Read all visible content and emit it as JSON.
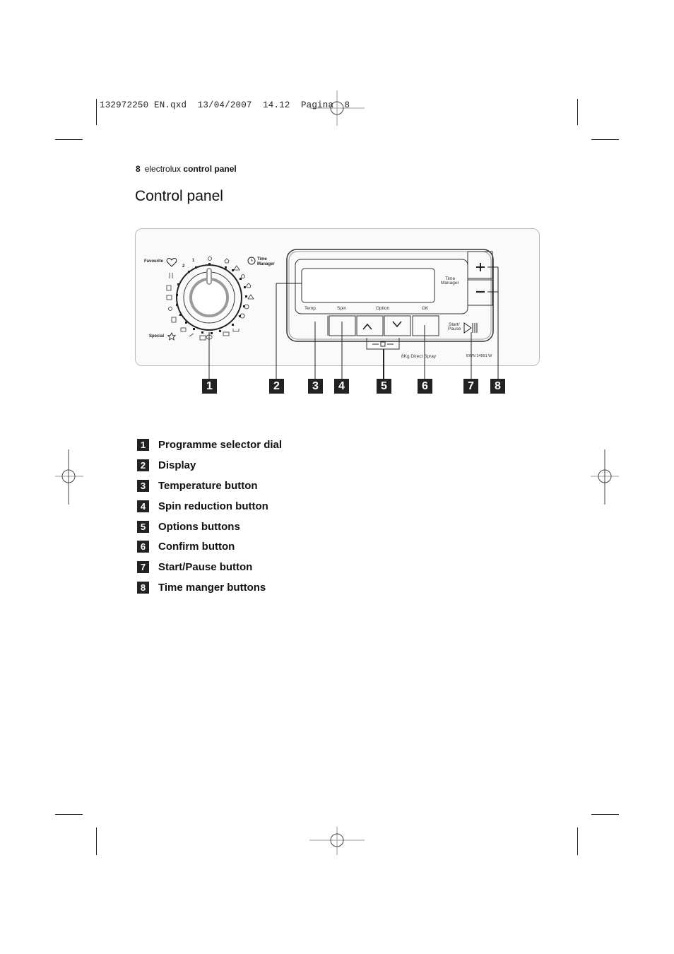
{
  "slug": {
    "text": "132972250 EN.qxd  13/04/2007  14.12  Pagina  8"
  },
  "running_head": {
    "page_number": "8",
    "brand": "electrolux",
    "section": "control panel"
  },
  "page_title": "Control panel",
  "panel": {
    "dial_labels": {
      "favourite": "Favourite",
      "special": "Special",
      "time_manager_line1": "Time",
      "time_manager_line2": "Manager",
      "pos_1": "1",
      "pos_2": "2"
    },
    "display_label_line1": "Time",
    "display_label_line2": "Manager",
    "button_labels": {
      "temp": "Temp.",
      "spin": "Spin",
      "option": "Option",
      "ok": "OK",
      "start_pause_line1": "Start/",
      "start_pause_line2": "Pause",
      "plus": "+",
      "minus": "−",
      "up": "^",
      "down": "v"
    },
    "model_text": "8Kg Direct Spray",
    "model_code": "EWN 14991 W"
  },
  "callouts": [
    "1",
    "2",
    "3",
    "4",
    "5",
    "6",
    "7",
    "8"
  ],
  "legend": [
    {
      "num": "1",
      "label": "Programme selector dial"
    },
    {
      "num": "2",
      "label": "Display"
    },
    {
      "num": "3",
      "label": "Temperature button"
    },
    {
      "num": "4",
      "label": "Spin reduction button"
    },
    {
      "num": "5",
      "label": "Options buttons"
    },
    {
      "num": "6",
      "label": "Confirm button"
    },
    {
      "num": "7",
      "label": "Start/Pause button"
    },
    {
      "num": "8",
      "label": "Time manger buttons"
    }
  ]
}
